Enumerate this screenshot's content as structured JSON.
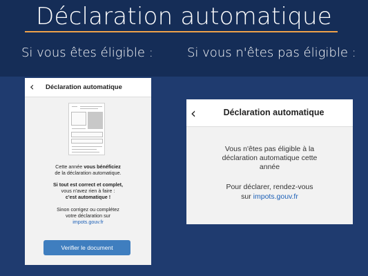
{
  "header": {
    "title": "Déclaration automatique",
    "left_heading": "Si vous êtes éligible :",
    "right_heading": "Si vous n'êtes pas éligible :"
  },
  "eligible_screen": {
    "app_title": "Déclaration automatique",
    "back_icon": "chevron-left-icon",
    "line1_part1": "Cette année ",
    "line1_bold": "vous bénéficiez",
    "line2": "de la déclaration automatique.",
    "line3_bold": "Si tout est correct et complet,",
    "line4": "vous n'avez rien à faire :",
    "line5_bold": "c'est automatique !",
    "line6": "Sinon corrigez ou complétez",
    "line7": "votre déclaration sur",
    "link": "impots.gouv.fr",
    "button_label": "Verifier le document"
  },
  "not_eligible_screen": {
    "app_title": "Déclaration automatique",
    "back_icon": "chevron-left-icon",
    "line1": "Vous n'êtes pas éligible à la",
    "line2": "déclaration automatique cette",
    "line3": "année",
    "line4": "Pour déclarer, rendez-vous",
    "line5_prefix": "sur ",
    "link": "impots.gouv.fr"
  },
  "colors": {
    "background": "#1f3b6f",
    "header_band": "#152d57",
    "title_rule": "#f0a24a",
    "button": "#3f7ebf",
    "link": "#1b5fb6"
  }
}
